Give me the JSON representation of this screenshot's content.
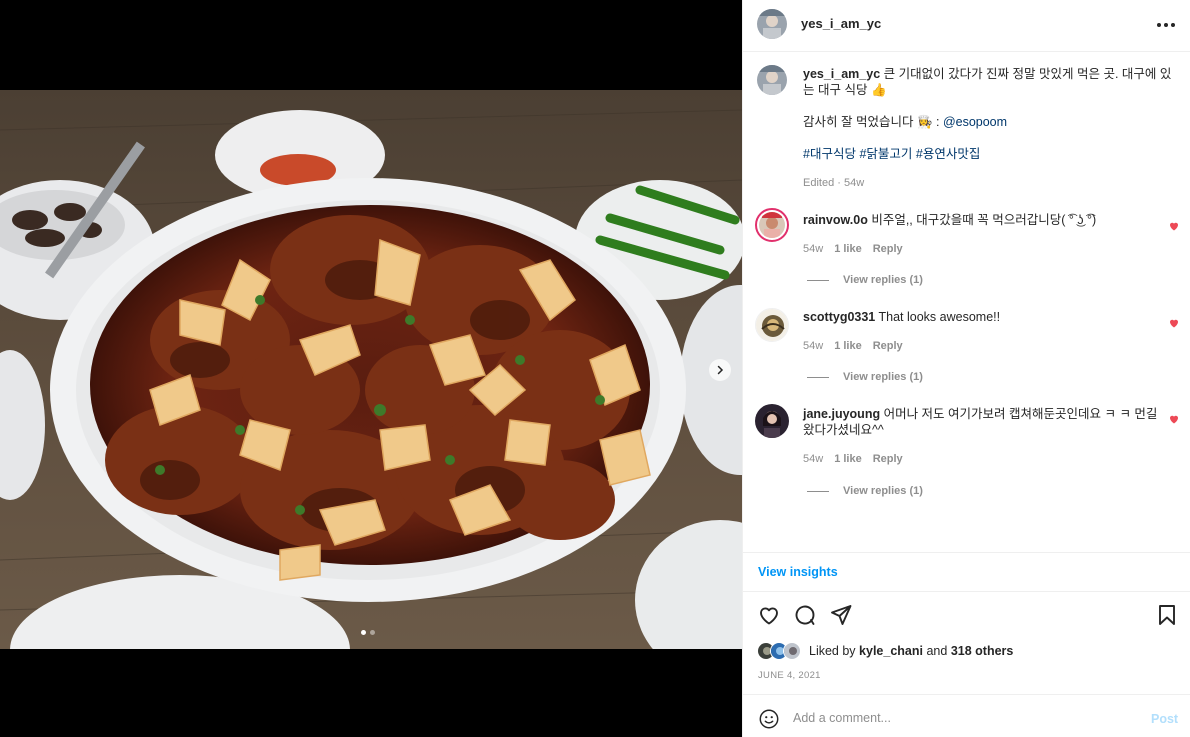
{
  "post": {
    "author": "yes_i_am_yc",
    "caption": {
      "line1": "큰 기대없이 갔다가 진짜 정말 맛있게 먹은 곳. 대구에 있는 대구 식당",
      "emoji_thumb": "👍",
      "thanks_text": "감사히 잘 먹었습니다",
      "emoji_cook": "👩‍🍳",
      "sep": " : ",
      "mention": "@esopoom",
      "hashtags": [
        "#대구식당",
        "#닭불고기",
        "#용연사맛집"
      ],
      "edited": "Edited · 54w"
    },
    "carousel": {
      "total": 2,
      "current": 1
    },
    "date": "JUNE 4, 2021"
  },
  "comments": [
    {
      "user": "rainvow.0o",
      "text": "비주얼,, 대구갔을때 꼭 먹으러갑니당( ͡° ͜ʖ ͡°)",
      "age": "54w",
      "likes": "1 like",
      "reply": "Reply",
      "view_replies": "View replies (1)",
      "liked": true
    },
    {
      "user": "scottyg0331",
      "text": "That looks awesome!!",
      "age": "54w",
      "likes": "1 like",
      "reply": "Reply",
      "view_replies": "View replies (1)",
      "liked": true
    },
    {
      "user": "jane.juyoung",
      "text": "어머나 저도 여기가보려 캡쳐해둔곳인데요 ㅋ ㅋ 먼길 왔다가셨네요^^",
      "age": "54w",
      "likes": "1 like",
      "reply": "Reply",
      "view_replies": "View replies (1)",
      "liked": true
    }
  ],
  "insights_label": "View insights",
  "likes": {
    "prefix": "Liked by",
    "user": "kyle_chani",
    "and": "and",
    "others": "318 others"
  },
  "comment_box": {
    "placeholder": "Add a comment...",
    "post_label": "Post"
  },
  "icons": [
    "more-icon",
    "heart-icon",
    "comment-icon",
    "share-icon",
    "bookmark-icon",
    "emoji-icon",
    "chevron-right-icon"
  ],
  "colors": {
    "accent": "#0095f6",
    "like_red": "#ed4956",
    "post_disabled": "#b2dffc",
    "meta": "#8e8e8e"
  }
}
